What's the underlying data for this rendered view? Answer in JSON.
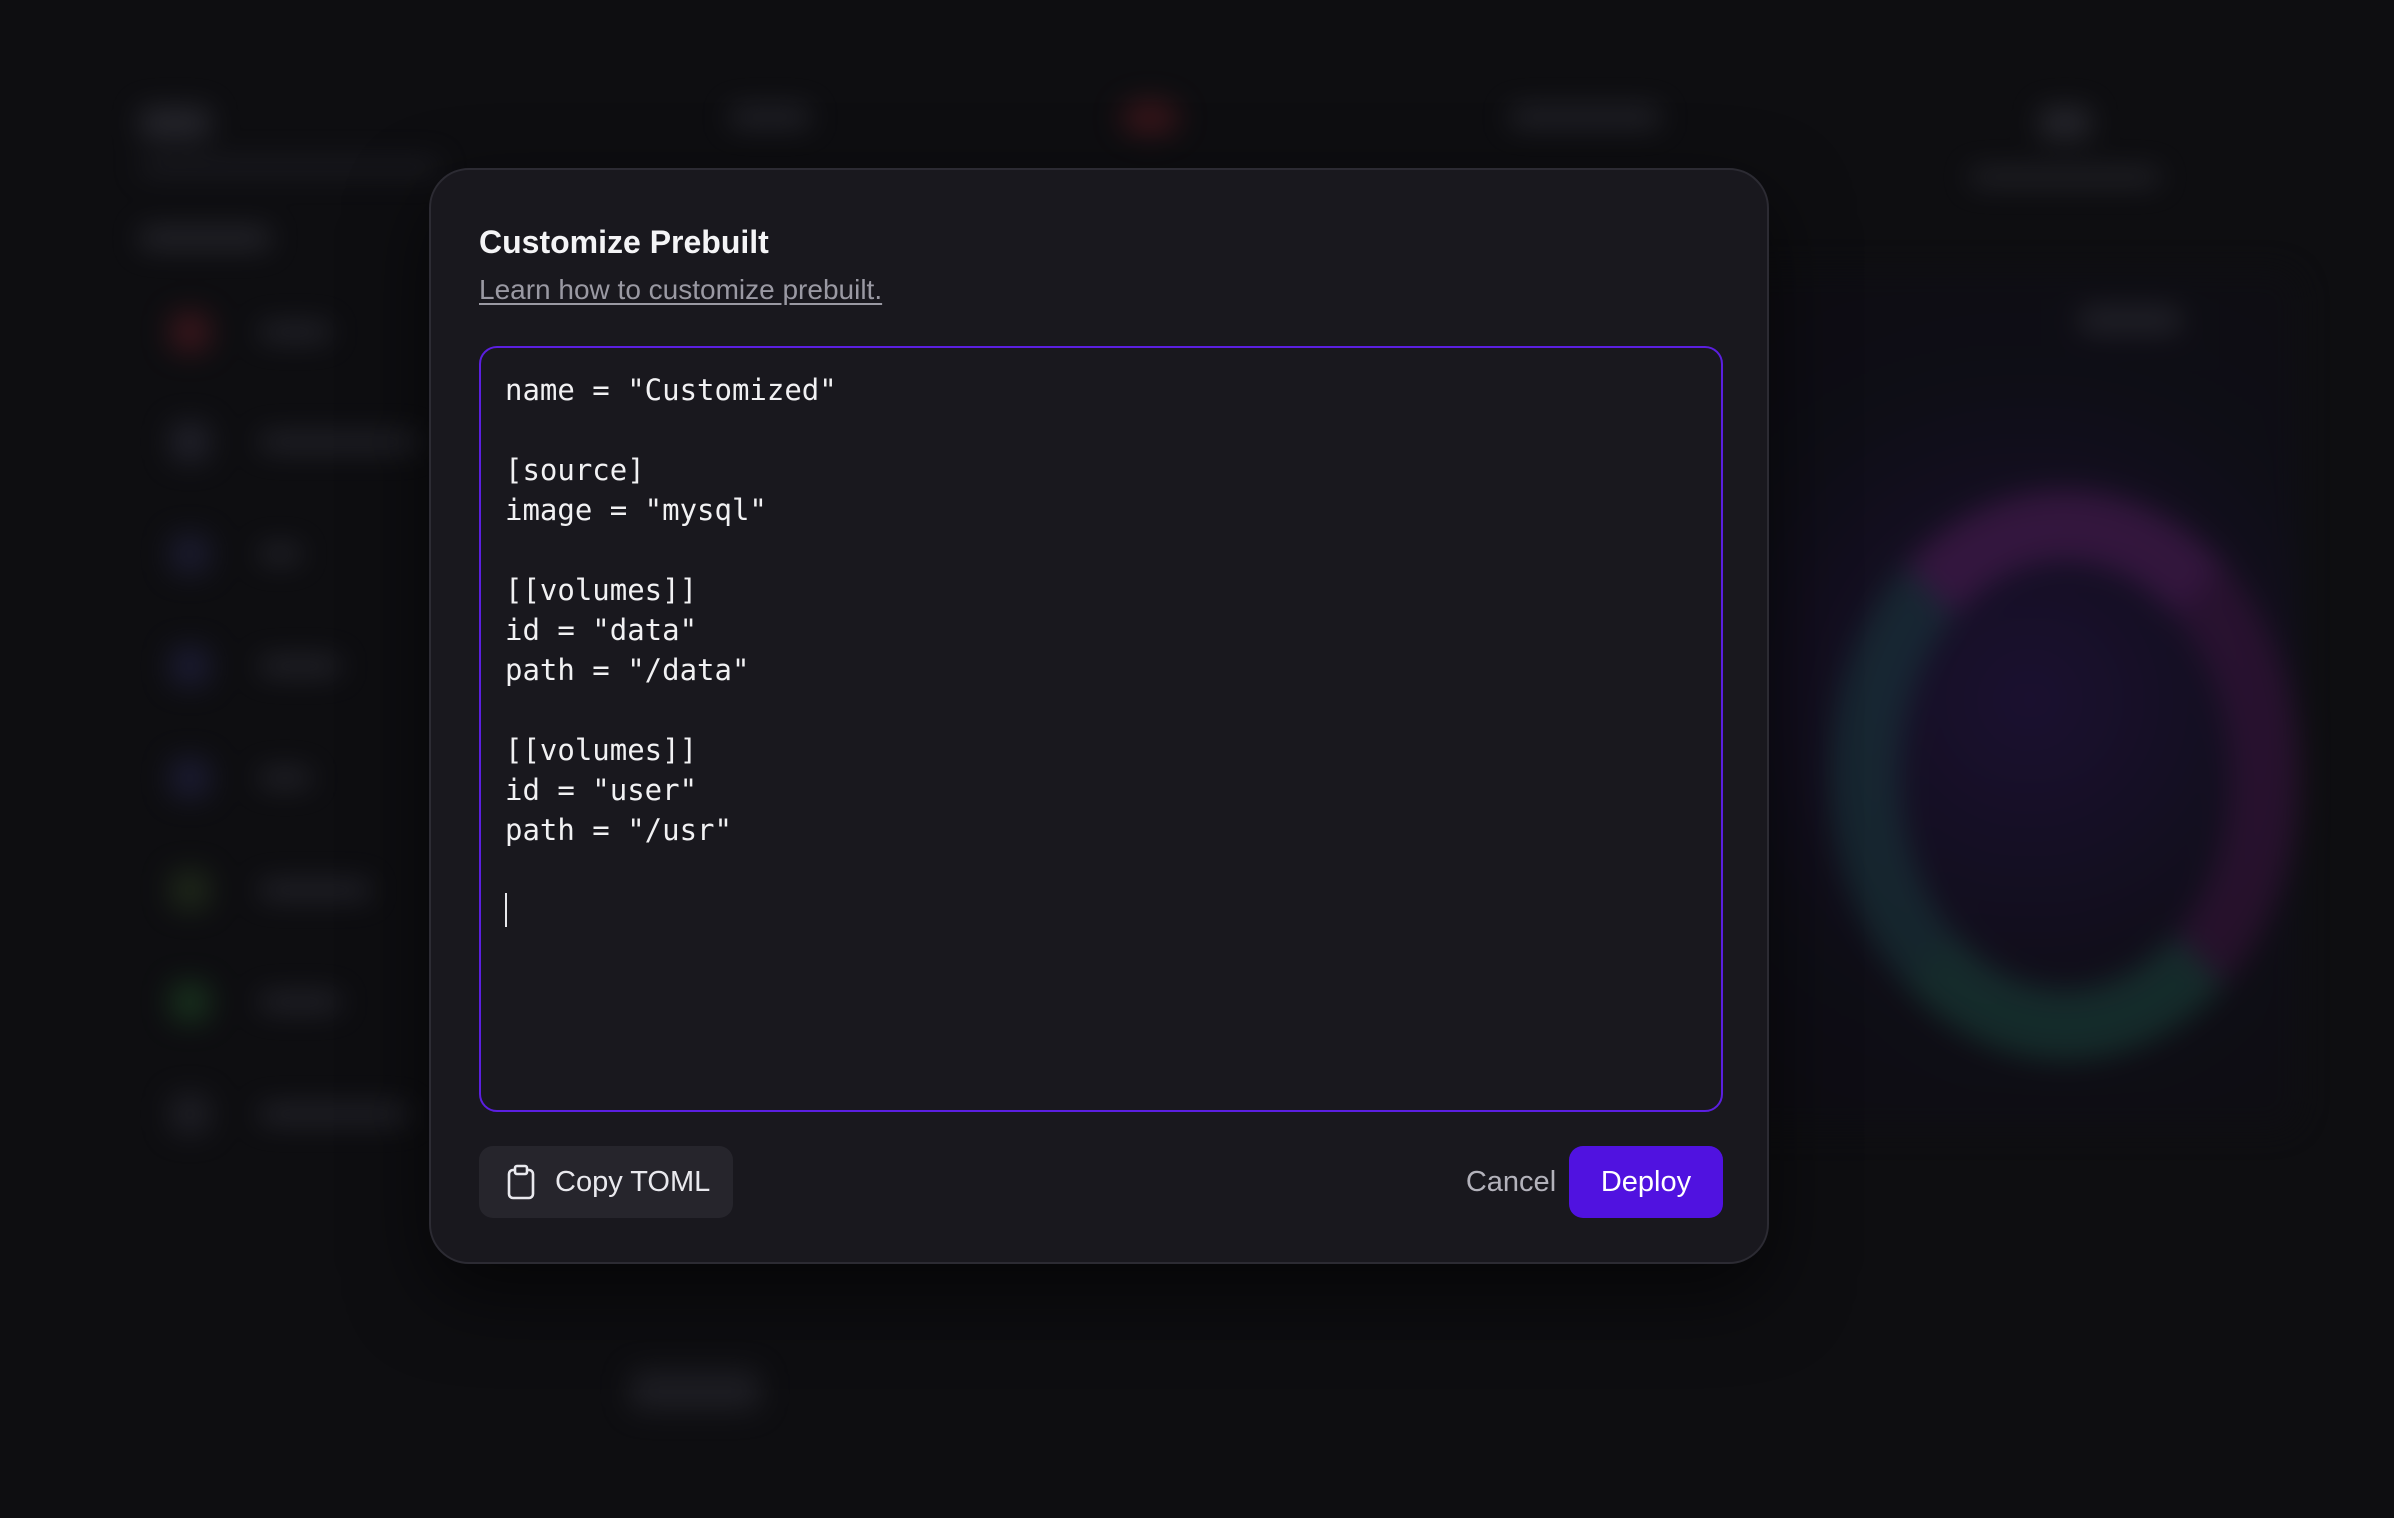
{
  "modal": {
    "title": "Customize Prebuilt",
    "help_link": "Learn how to customize prebuilt.",
    "editor_lines": [
      "name = \"Customized\"",
      "",
      "[source]",
      "image = \"mysql\"",
      "",
      "[[volumes]]",
      "id = \"data\"",
      "path = \"/data\"",
      "",
      "[[volumes]]",
      "id = \"user\"",
      "path = \"/usr\"",
      "",
      ""
    ],
    "copy_button": {
      "label": "Copy TOML",
      "icon": "clipboard-icon"
    },
    "cancel_button": {
      "label": "Cancel"
    },
    "deploy_button": {
      "label": "Deploy"
    }
  },
  "colors": {
    "accent": "#5012e0",
    "editor_border": "#5b1fe0",
    "modal_bg": "#19181e",
    "page_bg": "#0e0e11"
  }
}
